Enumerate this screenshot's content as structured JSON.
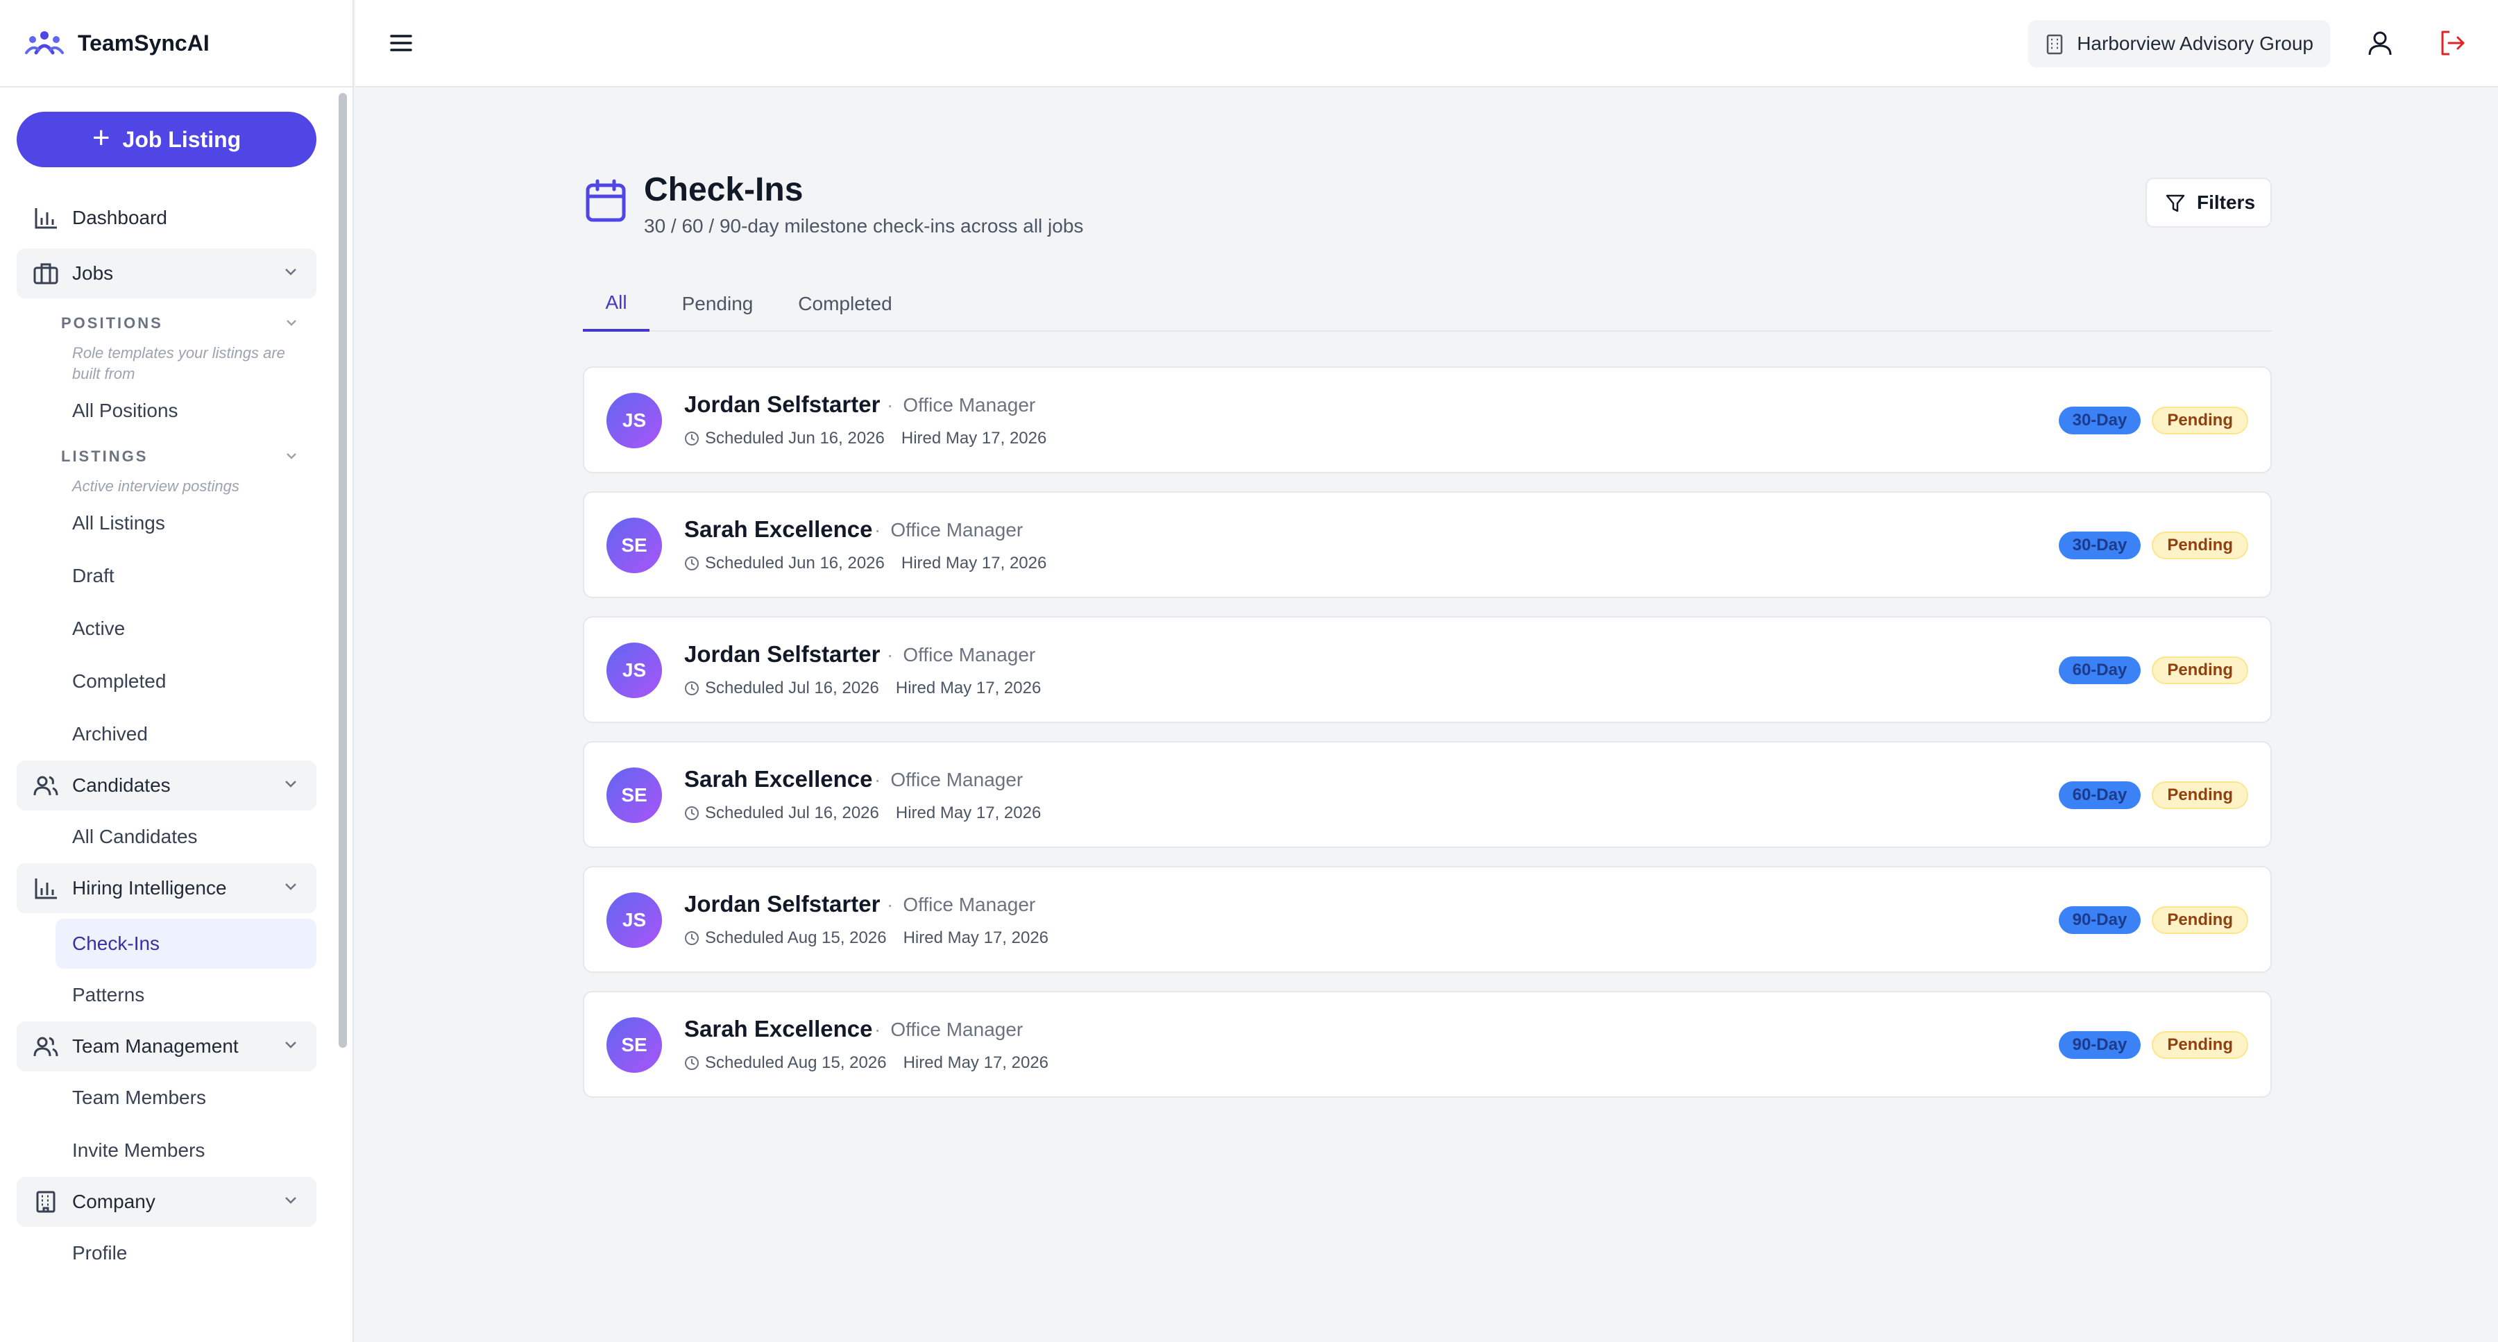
{
  "app": {
    "name": "TeamSyncAI"
  },
  "sidebar": {
    "primary_action": "Job Listing",
    "items": {
      "dashboard": "Dashboard",
      "jobs": "Jobs",
      "positions_header": "POSITIONS",
      "positions_hint": "Role templates your listings are built from",
      "all_positions": "All Positions",
      "listings_header": "LISTINGS",
      "listings_hint": "Active interview postings",
      "all_listings": "All Listings",
      "draft": "Draft",
      "active": "Active",
      "completed": "Completed",
      "archived": "Archived",
      "candidates": "Candidates",
      "all_candidates": "All Candidates",
      "hiring_intelligence": "Hiring Intelligence",
      "check_ins": "Check-Ins",
      "patterns": "Patterns",
      "team_management": "Team Management",
      "team_members": "Team Members",
      "invite_members": "Invite Members",
      "company": "Company",
      "profile": "Profile"
    }
  },
  "header": {
    "organization": "Harborview Advisory Group"
  },
  "page": {
    "title": "Check-Ins",
    "subtitle": "30 / 60 / 90-day milestone check-ins across all jobs",
    "filters_label": "Filters",
    "tabs": [
      "All",
      "Pending",
      "Completed"
    ],
    "active_tab": "All"
  },
  "checkins": [
    {
      "initials": "JS",
      "name": "Jordan Selfstarter",
      "role": "Office Manager",
      "scheduled": "Scheduled Jun 16, 2026",
      "hired": "Hired May 17, 2026",
      "milestone": "30-Day",
      "status": "Pending"
    },
    {
      "initials": "SE",
      "name": "Sarah Excellence",
      "role": "Office Manager",
      "scheduled": "Scheduled Jun 16, 2026",
      "hired": "Hired May 17, 2026",
      "milestone": "30-Day",
      "status": "Pending"
    },
    {
      "initials": "JS",
      "name": "Jordan Selfstarter",
      "role": "Office Manager",
      "scheduled": "Scheduled Jul 16, 2026",
      "hired": "Hired May 17, 2026",
      "milestone": "60-Day",
      "status": "Pending"
    },
    {
      "initials": "SE",
      "name": "Sarah Excellence",
      "role": "Office Manager",
      "scheduled": "Scheduled Jul 16, 2026",
      "hired": "Hired May 17, 2026",
      "milestone": "60-Day",
      "status": "Pending"
    },
    {
      "initials": "JS",
      "name": "Jordan Selfstarter",
      "role": "Office Manager",
      "scheduled": "Scheduled Aug 15, 2026",
      "hired": "Hired May 17, 2026",
      "milestone": "90-Day",
      "status": "Pending"
    },
    {
      "initials": "SE",
      "name": "Sarah Excellence",
      "role": "Office Manager",
      "scheduled": "Scheduled Aug 15, 2026",
      "hired": "Hired May 17, 2026",
      "milestone": "90-Day",
      "status": "Pending"
    }
  ],
  "colors": {
    "accent": "#4f46e5",
    "milestone_badge": "#3b82f6",
    "pending_badge": "#fef3c7",
    "logout": "#dc2626"
  },
  "icons": [
    "team-logo-icon",
    "plus-icon",
    "bar-chart-icon",
    "briefcase-icon",
    "users-icon",
    "building-icon",
    "chevron-down-icon",
    "menu-icon",
    "user-icon",
    "logout-icon",
    "calendar-icon",
    "filter-icon",
    "clock-icon"
  ]
}
